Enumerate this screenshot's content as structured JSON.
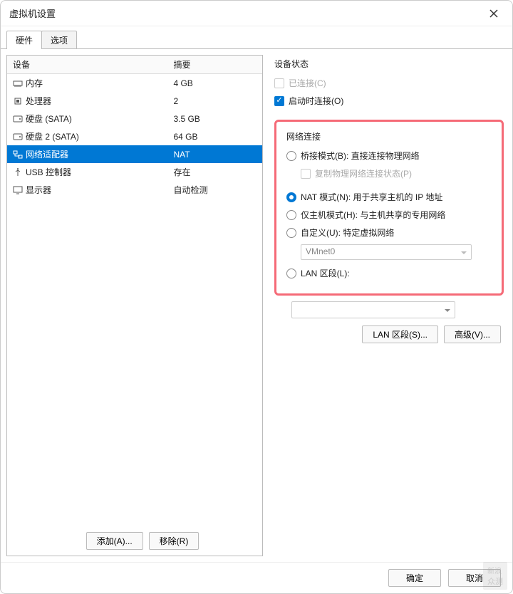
{
  "window": {
    "title": "虚拟机设置"
  },
  "tabs": {
    "hardware": "硬件",
    "options": "选项"
  },
  "table": {
    "header_device": "设备",
    "header_summary": "摘要",
    "rows": [
      {
        "name": "内存",
        "summary": "4 GB",
        "icon": "memory"
      },
      {
        "name": "处理器",
        "summary": "2",
        "icon": "cpu"
      },
      {
        "name": "硬盘 (SATA)",
        "summary": "3.5 GB",
        "icon": "disk"
      },
      {
        "name": "硬盘 2 (SATA)",
        "summary": "64 GB",
        "icon": "disk"
      },
      {
        "name": "网络适配器",
        "summary": "NAT",
        "icon": "network",
        "selected": true
      },
      {
        "name": "USB 控制器",
        "summary": "存在",
        "icon": "usb"
      },
      {
        "name": "显示器",
        "summary": "自动检测",
        "icon": "display"
      }
    ]
  },
  "left_buttons": {
    "add": "添加(A)...",
    "remove": "移除(R)"
  },
  "device_status": {
    "label": "设备状态",
    "connected": "已连接(C)",
    "connect_at_power_on": "启动时连接(O)"
  },
  "network": {
    "label": "网络连接",
    "bridged": "桥接模式(B): 直接连接物理网络",
    "replicate": "复制物理网络连接状态(P)",
    "nat": "NAT 模式(N): 用于共享主机的 IP 地址",
    "hostonly": "仅主机模式(H): 与主机共享的专用网络",
    "custom": "自定义(U): 特定虚拟网络",
    "vmnet_value": "VMnet0",
    "lan_segment": "LAN 区段(L):"
  },
  "row_buttons": {
    "lan_segments": "LAN 区段(S)...",
    "advanced": "高级(V)..."
  },
  "footer": {
    "ok": "确定",
    "cancel": "取消"
  },
  "watermark": {
    "line1": "新浪",
    "line2": "众测"
  }
}
